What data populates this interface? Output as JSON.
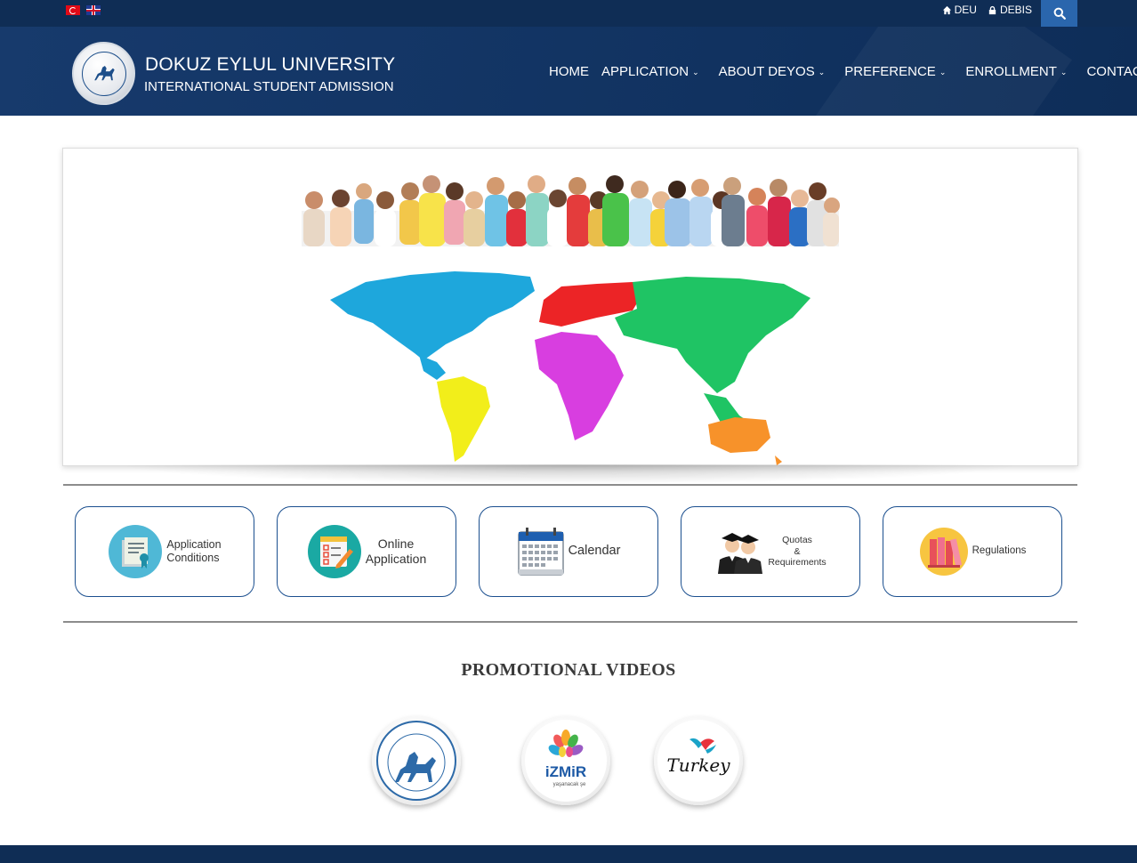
{
  "topbar": {
    "languages": [
      "Türkçe",
      "English"
    ],
    "links": [
      {
        "label": "DEU",
        "icon": "home-icon"
      },
      {
        "label": "DEBIS",
        "icon": "lock-icon"
      }
    ],
    "search_icon": "search-icon"
  },
  "header": {
    "title": "DOKUZ EYLUL UNIVERSITY",
    "subtitle": "INTERNATIONAL STUDENT ADMISSION",
    "nav": [
      {
        "label": "HOME",
        "has_dropdown": false
      },
      {
        "label": "APPLICATION",
        "has_dropdown": true
      },
      {
        "label": "ABOUT DEYOS",
        "has_dropdown": true
      },
      {
        "label": "PREFERENCE",
        "has_dropdown": true
      },
      {
        "label": "ENROLLMENT",
        "has_dropdown": true
      },
      {
        "label": "CONTACT",
        "has_dropdown": false
      }
    ]
  },
  "quick_links": [
    {
      "label": "Application\nConditions",
      "icon": "certificate-icon"
    },
    {
      "label": "Online\nApplication",
      "icon": "checklist-icon"
    },
    {
      "label": "Calendar",
      "icon": "calendar-icon"
    },
    {
      "label": "Quotas\n&\nRequirements",
      "icon": "graduates-icon"
    },
    {
      "label": "Regulations",
      "icon": "books-icon"
    }
  ],
  "promo": {
    "title": "PROMOTIONAL VIDEOS",
    "videos": [
      {
        "icon": "deu-seal-icon"
      },
      {
        "icon": "izmir-logo-icon",
        "text": "iZMiR",
        "tagline": "yaşanacak şe"
      },
      {
        "icon": "turkey-logo-icon",
        "text": "Turkey"
      }
    ]
  },
  "colors": {
    "navy": "#0f2d55",
    "header": "#123463",
    "search_bg": "#2a66ad",
    "card_border": "#1b4f8f"
  }
}
